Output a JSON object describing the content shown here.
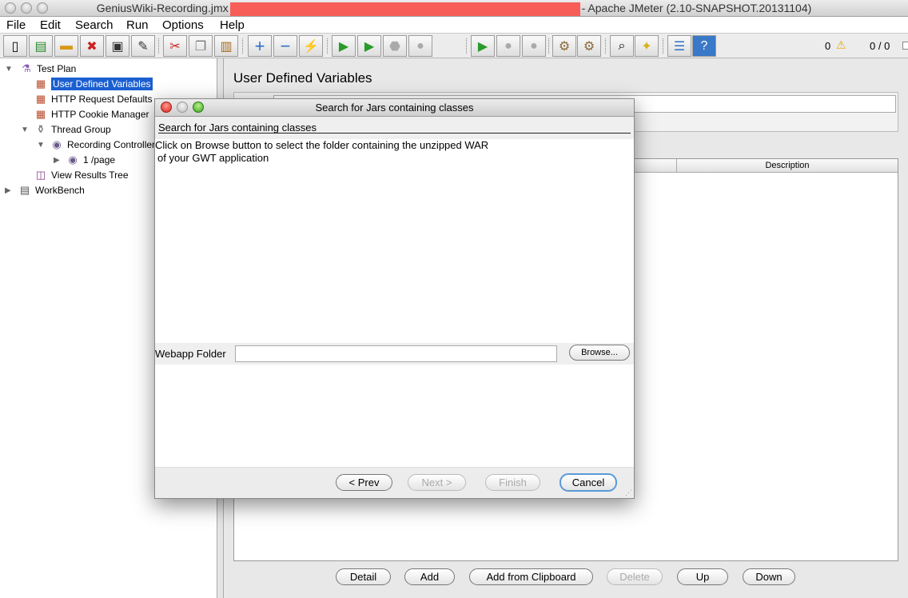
{
  "window": {
    "title": "GeniusWiki-Recording.jmx",
    "title_suffix": "- Apache JMeter (2.10-SNAPSHOT.20131104)"
  },
  "menu": [
    "File",
    "Edit",
    "Search",
    "Run",
    "Options",
    "Help"
  ],
  "toolbar": {
    "icons": [
      "new-icon",
      "templates-icon",
      "open-icon",
      "close-icon",
      "save-icon",
      "save-as-icon",
      "cut-icon",
      "copy-icon",
      "paste-icon",
      "expand-icon",
      "collapse-icon",
      "toggle-icon",
      "start-icon",
      "start-no-pause-icon",
      "stop-icon",
      "shutdown-icon",
      "remote-start-all-icon",
      "remote-stop-all-icon",
      "remote-shutdown-all-icon",
      "clear-icon",
      "clear-all-icon",
      "search-icon",
      "reset-search-icon",
      "function-helper-icon",
      "help-icon"
    ],
    "warning_count": "0",
    "thread_count": "0 / 0"
  },
  "tree": [
    {
      "label": "Test Plan",
      "icon": "test-plan-icon"
    },
    {
      "label": "User Defined Variables",
      "icon": "config-icon"
    },
    {
      "label": "HTTP Request Defaults",
      "icon": "config-icon"
    },
    {
      "label": "HTTP Cookie Manager",
      "icon": "config-icon"
    },
    {
      "label": "Thread Group",
      "icon": "thread-group-icon"
    },
    {
      "label": "Recording Controller",
      "icon": "controller-icon"
    },
    {
      "label": "1 /page",
      "icon": "sampler-icon"
    },
    {
      "label": "View Results Tree",
      "icon": "listener-icon"
    },
    {
      "label": "WorkBench",
      "icon": "workbench-icon"
    }
  ],
  "panel": {
    "title": "User Defined Variables",
    "table_header_description": "Description",
    "buttons": [
      "Detail",
      "Add",
      "Add from Clipboard",
      "Delete",
      "Up",
      "Down"
    ]
  },
  "dialog": {
    "title": "Search for Jars containing classes",
    "heading": "Search for Jars containing classes",
    "instructions": [
      "Click on Browse button to select the folder containing the unzipped WAR",
      "of your GWT application"
    ],
    "folder_label": "Webapp Folder",
    "folder_value": "",
    "browse": "Browse...",
    "buttons": {
      "prev": "< Prev",
      "next": "Next >",
      "finish": "Finish",
      "cancel": "Cancel"
    }
  }
}
